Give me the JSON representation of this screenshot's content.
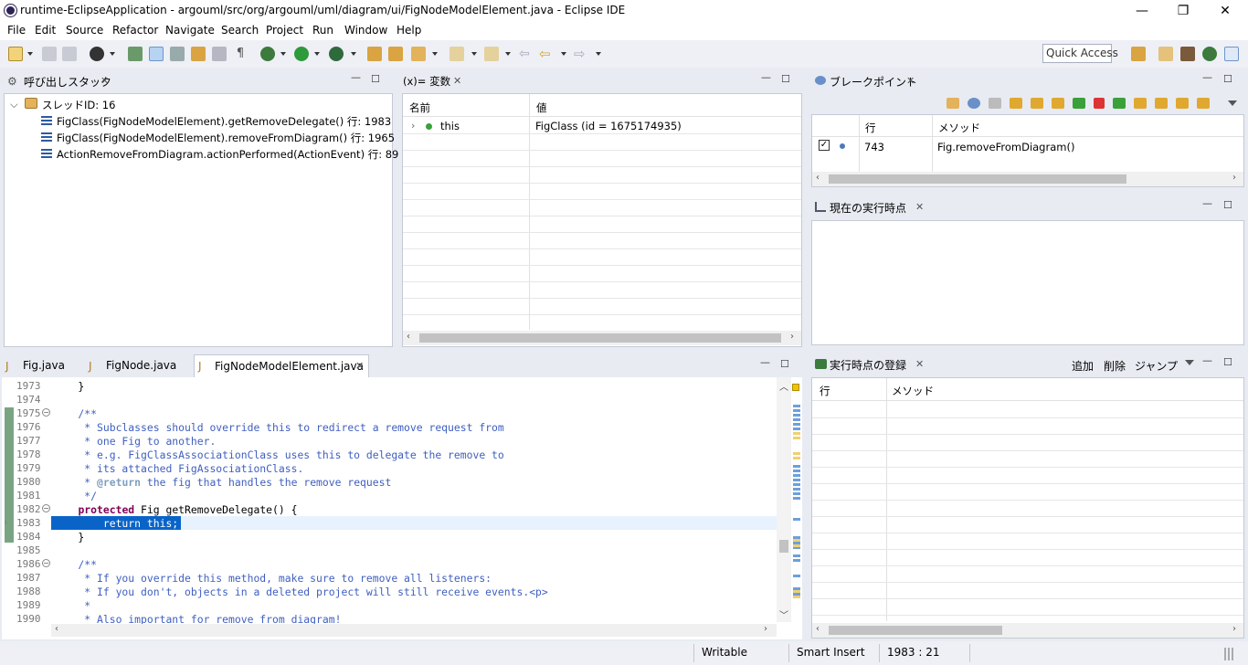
{
  "window": {
    "title": "runtime-EclipseApplication - argouml/src/org/argouml/uml/diagram/ui/FigNodeModelElement.java - Eclipse IDE",
    "minimize": "—",
    "restore": "❐",
    "close": "✕"
  },
  "menu": [
    "File",
    "Edit",
    "Source",
    "Refactor",
    "Navigate",
    "Search",
    "Project",
    "Run",
    "Window",
    "Help"
  ],
  "toolbar": {
    "quick_access": "Quick Access"
  },
  "callstack": {
    "tab_label": "呼び出しスタック",
    "thread": "スレッドID: 16",
    "frames": [
      "FigClass(FigNodeModelElement).getRemoveDelegate() 行: 1983",
      "FigClass(FigNodeModelElement).removeFromDiagram() 行: 1965",
      "ActionRemoveFromDiagram.actionPerformed(ActionEvent) 行: 89"
    ]
  },
  "variables": {
    "tab_label": "(x)= 変数",
    "col_name": "名前",
    "col_value": "値",
    "rows": [
      {
        "name": "this",
        "value": "FigClass (id = 1675174935)"
      }
    ]
  },
  "breakpoints": {
    "tab_label": "ブレークポイント",
    "col_line": "行",
    "col_method": "メソッド",
    "rows": [
      {
        "line": "743",
        "method": "Fig.removeFromDiagram()",
        "checked": true
      }
    ]
  },
  "current_exec": {
    "tab_label": "現在の実行時点"
  },
  "exec_register": {
    "tab_label": "実行時点の登録",
    "add": "追加",
    "delete": "削除",
    "jump": "ジャンプ",
    "col_line": "行",
    "col_method": "メソッド"
  },
  "editor": {
    "tabs": [
      "Fig.java",
      "FigNode.java",
      "FigNodeModelElement.java"
    ],
    "active_tab": 2,
    "lines": [
      {
        "n": "1973",
        "text": "    }"
      },
      {
        "n": "1974",
        "text": ""
      },
      {
        "n": "1975",
        "text": "    /**",
        "fold": true
      },
      {
        "n": "1976",
        "text": "     * Subclasses should override this to redirect a remove request from"
      },
      {
        "n": "1977",
        "text": "     * one Fig to another."
      },
      {
        "n": "1978",
        "text": "     * e.g. FigClassAssociationClass uses this to delegate the remove to"
      },
      {
        "n": "1979",
        "text": "     * its attached FigAssociationClass."
      },
      {
        "n": "1980",
        "text": "     * @return the fig that handles the remove request"
      },
      {
        "n": "1981",
        "text": "     */"
      },
      {
        "n": "1982",
        "text": "    protected Fig getRemoveDelegate() {",
        "fold": true
      },
      {
        "n": "1983",
        "text": "        return this;"
      },
      {
        "n": "1984",
        "text": "    }"
      },
      {
        "n": "1985",
        "text": ""
      },
      {
        "n": "1986",
        "text": "    /**",
        "fold": true
      },
      {
        "n": "1987",
        "text": "     * If you override this method, make sure to remove all listeners:"
      },
      {
        "n": "1988",
        "text": "     * If you don't, objects in a deleted project will still receive events.<p>"
      },
      {
        "n": "1989",
        "text": "     *"
      },
      {
        "n": "1990",
        "text": "     * Also important for remove from diagram!"
      }
    ]
  },
  "status": {
    "writable": "Writable",
    "insert_mode": "Smart Insert",
    "position": "1983 : 21"
  },
  "colors": {
    "selection": "#0a64c8",
    "current_line": "#e8f2fe",
    "comment": "#3f5fbf",
    "keyword": "#7f0055"
  }
}
